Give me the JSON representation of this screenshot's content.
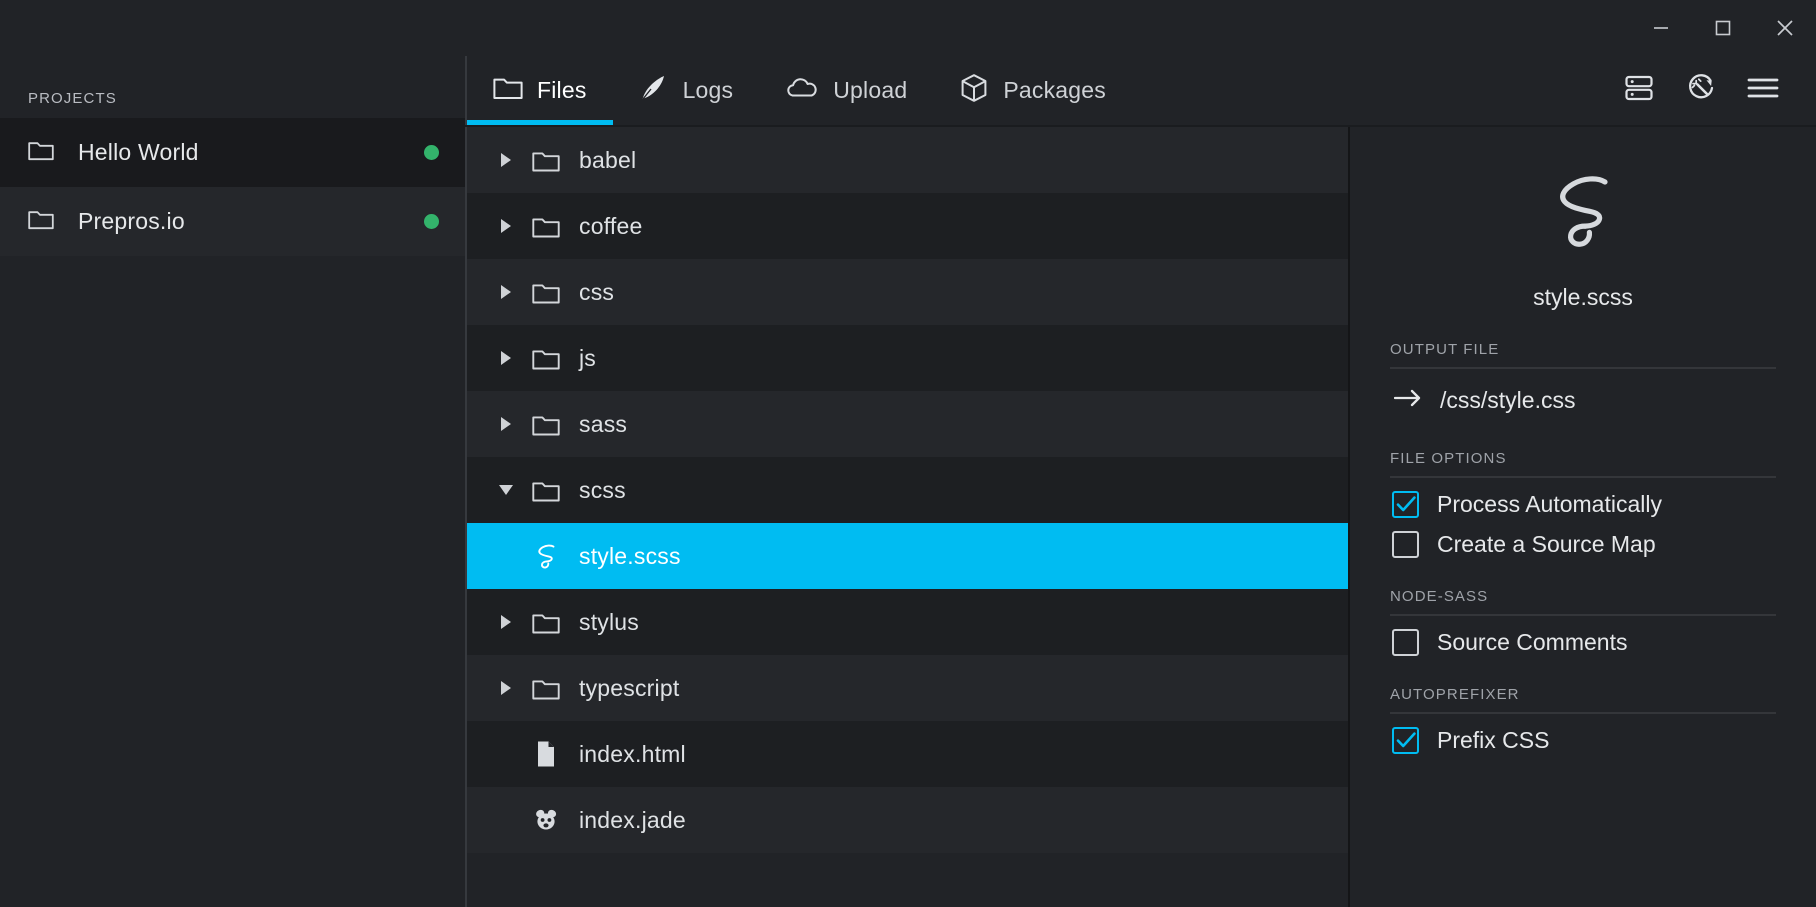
{
  "window": {
    "controls": [
      {
        "name": "minimize-button",
        "glyph": "minimize"
      },
      {
        "name": "maximize-button",
        "glyph": "maximize"
      },
      {
        "name": "close-button",
        "glyph": "close"
      }
    ]
  },
  "colors": {
    "accent": "#00bcf2",
    "status_online": "#33b36b",
    "background": "#212327",
    "row_alt": "#25272b",
    "text": "#e6e8ea"
  },
  "sidebar": {
    "heading": "PROJECTS",
    "projects": [
      {
        "label": "Hello World",
        "icon": "folder-icon",
        "status": "online",
        "active": true
      },
      {
        "label": "Prepros.io",
        "icon": "folder-icon",
        "status": "online",
        "active": false
      }
    ]
  },
  "tabbar": {
    "tabs": [
      {
        "label": "Files",
        "icon": "folder-icon",
        "active": true
      },
      {
        "label": "Logs",
        "icon": "feather-icon",
        "active": false
      },
      {
        "label": "Upload",
        "icon": "cloud-icon",
        "active": false
      },
      {
        "label": "Packages",
        "icon": "package-icon",
        "active": false
      }
    ],
    "tools": [
      {
        "name": "server-icon",
        "title": "server"
      },
      {
        "name": "magic-wand-refresh-icon",
        "title": "process"
      },
      {
        "name": "hamburger-menu-icon",
        "title": "menu"
      }
    ]
  },
  "filetree": {
    "items": [
      {
        "label": "babel",
        "type": "folder",
        "expanded": false,
        "depth": 0
      },
      {
        "label": "coffee",
        "type": "folder",
        "expanded": false,
        "depth": 0
      },
      {
        "label": "css",
        "type": "folder",
        "expanded": false,
        "depth": 0
      },
      {
        "label": "js",
        "type": "folder",
        "expanded": false,
        "depth": 0
      },
      {
        "label": "sass",
        "type": "folder",
        "expanded": false,
        "depth": 0
      },
      {
        "label": "scss",
        "type": "folder",
        "expanded": true,
        "depth": 0
      },
      {
        "label": "style.scss",
        "type": "sass",
        "selected": true,
        "depth": 1
      },
      {
        "label": "stylus",
        "type": "folder",
        "expanded": false,
        "depth": 0
      },
      {
        "label": "typescript",
        "type": "folder",
        "expanded": false,
        "depth": 0
      },
      {
        "label": "index.html",
        "type": "file",
        "depth": 0
      },
      {
        "label": "index.jade",
        "type": "jade",
        "depth": 0
      }
    ]
  },
  "inspector": {
    "file_icon": "sass-icon",
    "filename": "style.scss",
    "sections": [
      {
        "title": "OUTPUT FILE",
        "kind": "output",
        "icon": "arrow-right-icon",
        "value": "/css/style.css"
      },
      {
        "title": "FILE OPTIONS",
        "kind": "checkboxes",
        "options": [
          {
            "label": "Process Automatically",
            "checked": true
          },
          {
            "label": "Create a Source Map",
            "checked": false
          }
        ]
      },
      {
        "title": "NODE-SASS",
        "kind": "checkboxes",
        "options": [
          {
            "label": "Source Comments",
            "checked": false
          }
        ]
      },
      {
        "title": "AUTOPREFIXER",
        "kind": "checkboxes",
        "options": [
          {
            "label": "Prefix CSS",
            "checked": true
          }
        ]
      }
    ]
  }
}
